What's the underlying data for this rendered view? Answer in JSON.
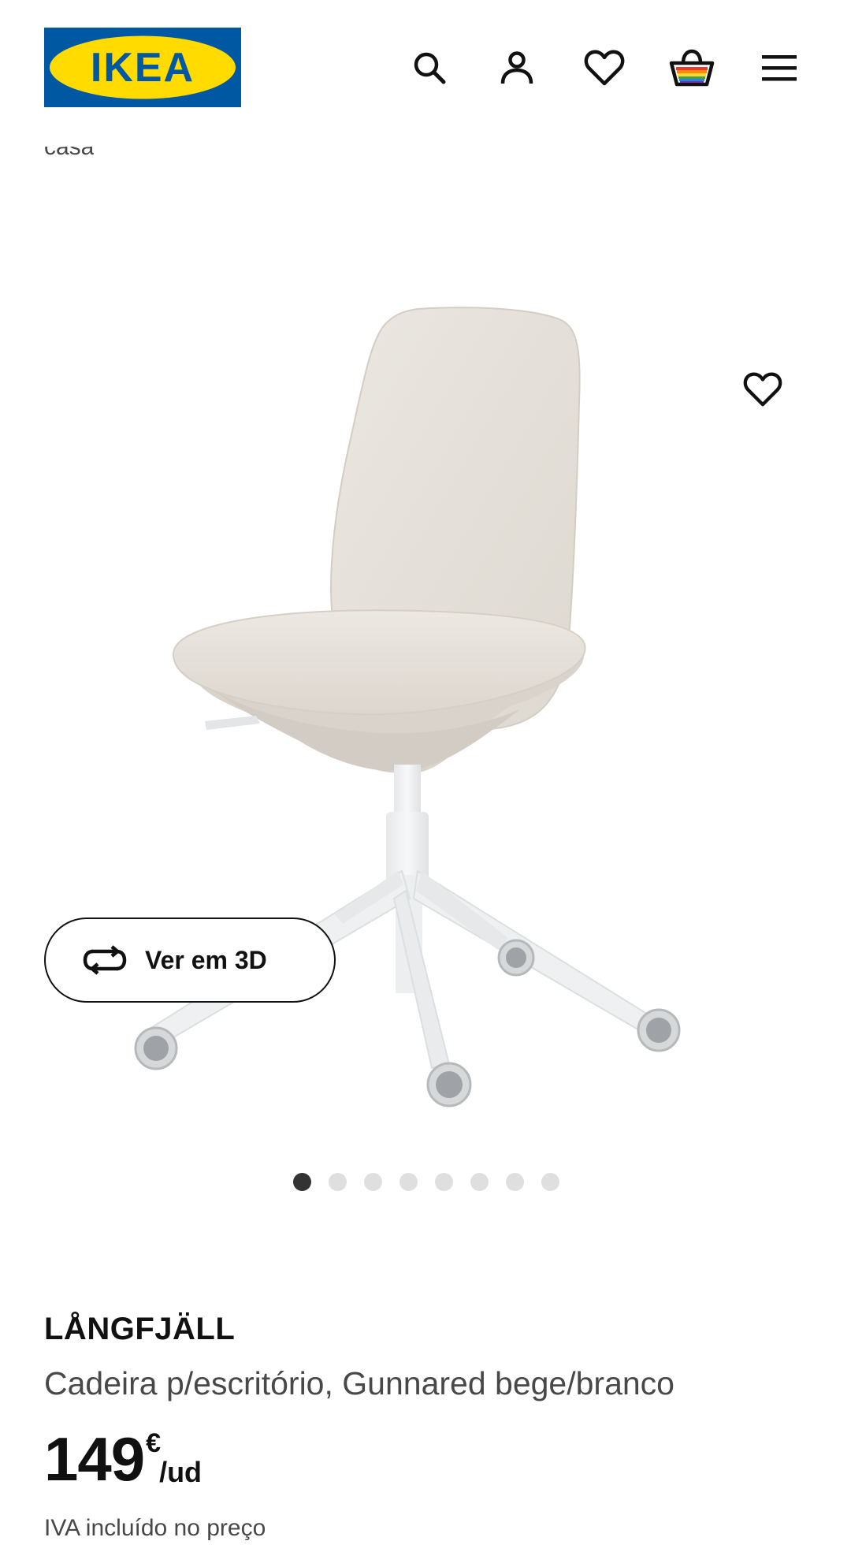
{
  "header": {
    "logo_text": "IKEA",
    "icons": [
      "search-icon",
      "account-icon",
      "favourites-icon",
      "cart-icon",
      "menu-icon"
    ]
  },
  "breadcrumb_peek": "casa",
  "gallery": {
    "ver_3d_label": "Ver em 3D",
    "dot_count": 8,
    "active_index": 0
  },
  "product": {
    "name": "LÅNGFJÄLL",
    "description": "Cadeira p/escritório, Gunnared bege/branco",
    "price_amount": "149",
    "price_currency": "€",
    "price_unit": "/ud",
    "vat_note": "IVA incluído no preço"
  },
  "colors": {
    "ikea_blue": "#0058A3",
    "ikea_yellow": "#FFDB00",
    "text_primary": "#111111",
    "text_secondary": "#484848"
  }
}
